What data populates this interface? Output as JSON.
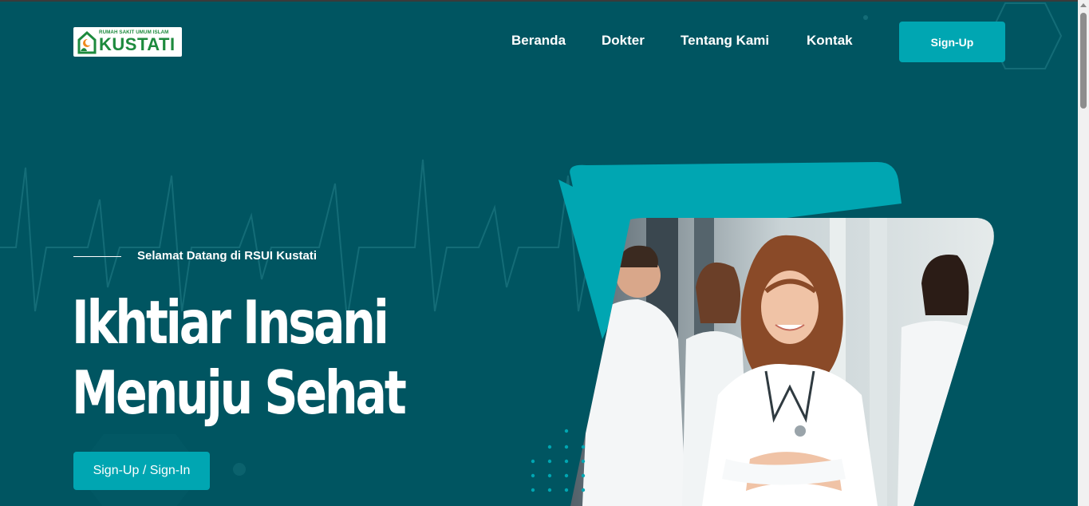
{
  "logo": {
    "tagline": "RUMAH SAKIT UMUM ISLAM",
    "name": "KUSTATI",
    "brand_color": "#1d8a3d"
  },
  "nav": {
    "items": [
      {
        "label": "Beranda"
      },
      {
        "label": "Dokter"
      },
      {
        "label": "Tentang Kami"
      },
      {
        "label": "Kontak"
      }
    ],
    "signup_label": "Sign-Up"
  },
  "hero": {
    "subtitle": "Selamat Datang di RSUI Kustati",
    "title_line1": "Ikhtiar Insani",
    "title_line2": "Menuju Sehat",
    "cta_label": "Sign-Up / Sign-In"
  },
  "colors": {
    "background": "#005561",
    "accent": "#00a6b2",
    "text": "#ffffff"
  }
}
